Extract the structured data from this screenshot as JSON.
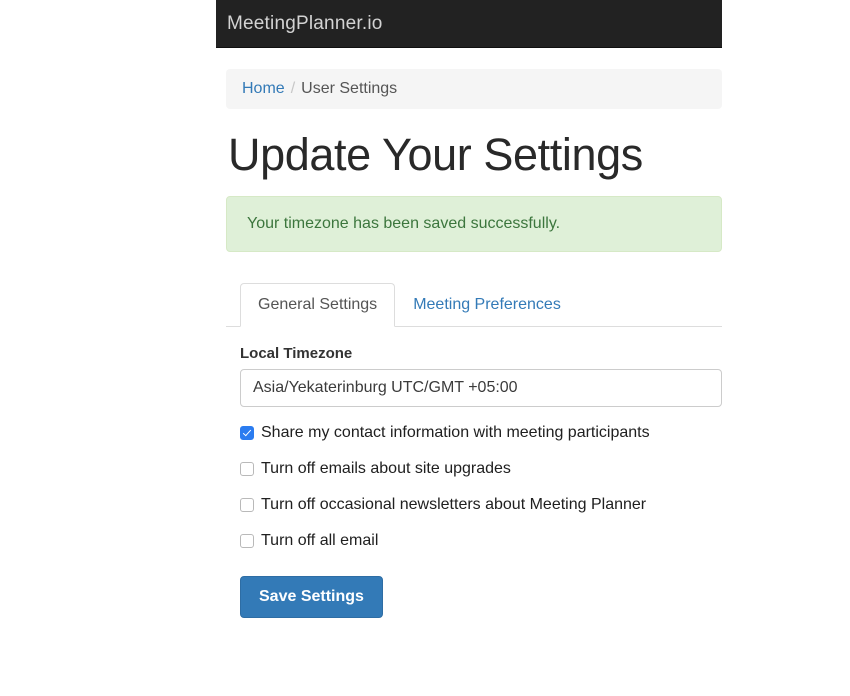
{
  "navbar": {
    "brand": "MeetingPlanner.io"
  },
  "breadcrumb": {
    "home_label": "Home",
    "separator": "/",
    "current_label": "User Settings"
  },
  "page": {
    "title": "Update Your Settings"
  },
  "alert": {
    "message": "Your timezone has been saved successfully.",
    "background_color": "#dff0d8",
    "text_color": "#3c763d"
  },
  "tabs": [
    {
      "label": "General Settings",
      "active": true
    },
    {
      "label": "Meeting Preferences",
      "active": false
    }
  ],
  "form": {
    "timezone": {
      "label": "Local Timezone",
      "selected_value": "Asia/Yekaterinburg UTC/GMT +05:00"
    },
    "checkboxes": [
      {
        "label": "Share my contact information with meeting participants",
        "checked": true
      },
      {
        "label": "Turn off emails about site upgrades",
        "checked": false
      },
      {
        "label": "Turn off occasional newsletters about Meeting Planner",
        "checked": false
      },
      {
        "label": "Turn off all email",
        "checked": false
      }
    ],
    "save_button": "Save Settings"
  },
  "colors": {
    "navbar_bg": "#222222",
    "link": "#337ab7",
    "primary_button": "#337ab7",
    "checkbox_checked": "#2b7cf0"
  }
}
